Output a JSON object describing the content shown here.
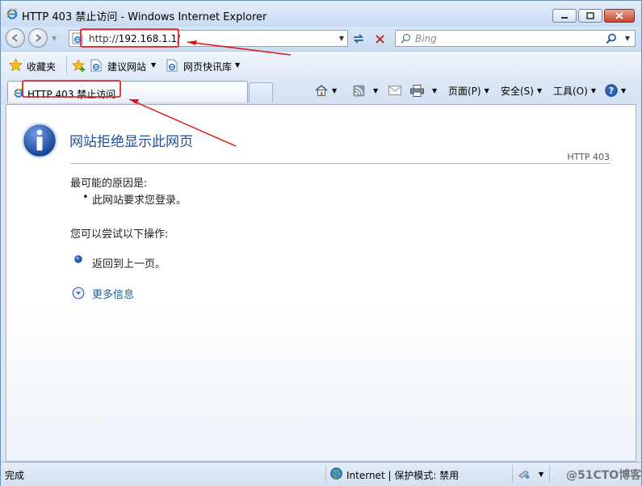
{
  "window": {
    "title": "HTTP 403 禁止访问 - Windows Internet Explorer",
    "minimize_icon": "minimize-icon",
    "maximize_icon": "maximize-icon",
    "close_icon": "close-icon"
  },
  "address": {
    "scheme": "http://",
    "host": "192.168.1.1",
    "path": "/"
  },
  "search": {
    "placeholder": "Bing"
  },
  "favorites": {
    "label": "收藏夹",
    "items": [
      {
        "label": "建议网站"
      },
      {
        "label": "网页快讯库"
      }
    ]
  },
  "tab": {
    "label": "HTTP 403 禁止访问"
  },
  "command_bar": {
    "page": "页面(P)",
    "safety": "安全(S)",
    "tools": "工具(O)"
  },
  "content": {
    "title": "网站拒绝显示此网页",
    "code": "HTTP 403",
    "reason_heading": "最可能的原因是:",
    "reasons": [
      "此网站要求您登录。"
    ],
    "try_heading": "您可以尝试以下操作:",
    "back_link": "返回到上一页。",
    "more_info": "更多信息"
  },
  "status": {
    "text": "完成",
    "zone": "Internet | 保护模式: 禁用",
    "watermark": "@51CTO博客"
  },
  "colors": {
    "title_blue": "#1f4e9a",
    "annotation_red": "#e01010",
    "link_blue": "#1f5e9e"
  }
}
